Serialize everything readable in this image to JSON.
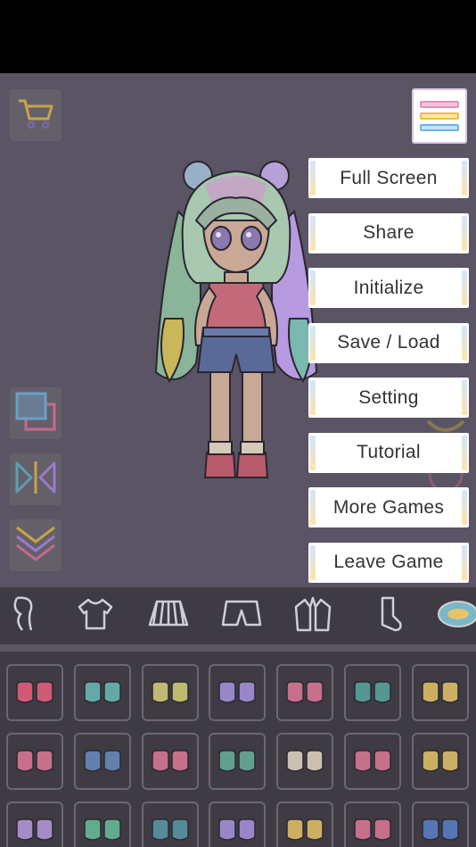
{
  "menu": {
    "items": [
      "Full Screen",
      "Share",
      "Initialize",
      "Save / Load",
      "Setting",
      "Tutorial",
      "More Games",
      "Leave Game"
    ]
  },
  "icons": {
    "cart": "cart-icon",
    "menu": "hamburger-menu-icon",
    "layer": "layers-icon",
    "flip": "flip-icon",
    "collapse": "double-chevron-down-icon"
  },
  "categories": [
    "hair",
    "shirt",
    "skirt",
    "shorts",
    "jacket",
    "socks",
    "accessory"
  ],
  "items": {
    "rows": [
      [
        "#e8607e",
        "#6cbdb8",
        "#d6d07a",
        "#a894e0",
        "#e07a98",
        "#5aa89e",
        "#e6c46a"
      ],
      [
        "#e07a98",
        "#6a8cc0",
        "#e07a98",
        "#68b29c",
        "#e4d8c4",
        "#e07a98",
        "#e6c46a"
      ],
      [
        "#b89ae0",
        "#68c09c",
        "#5a9aa8",
        "#a894e0",
        "#e6c46a",
        "#e07a98",
        "#5a80c8"
      ]
    ]
  },
  "colors": {
    "menu_bar_pink": "#f7a8c8",
    "menu_bar_yellow": "#ffe08a",
    "menu_bar_blue": "#a8d4f8"
  }
}
